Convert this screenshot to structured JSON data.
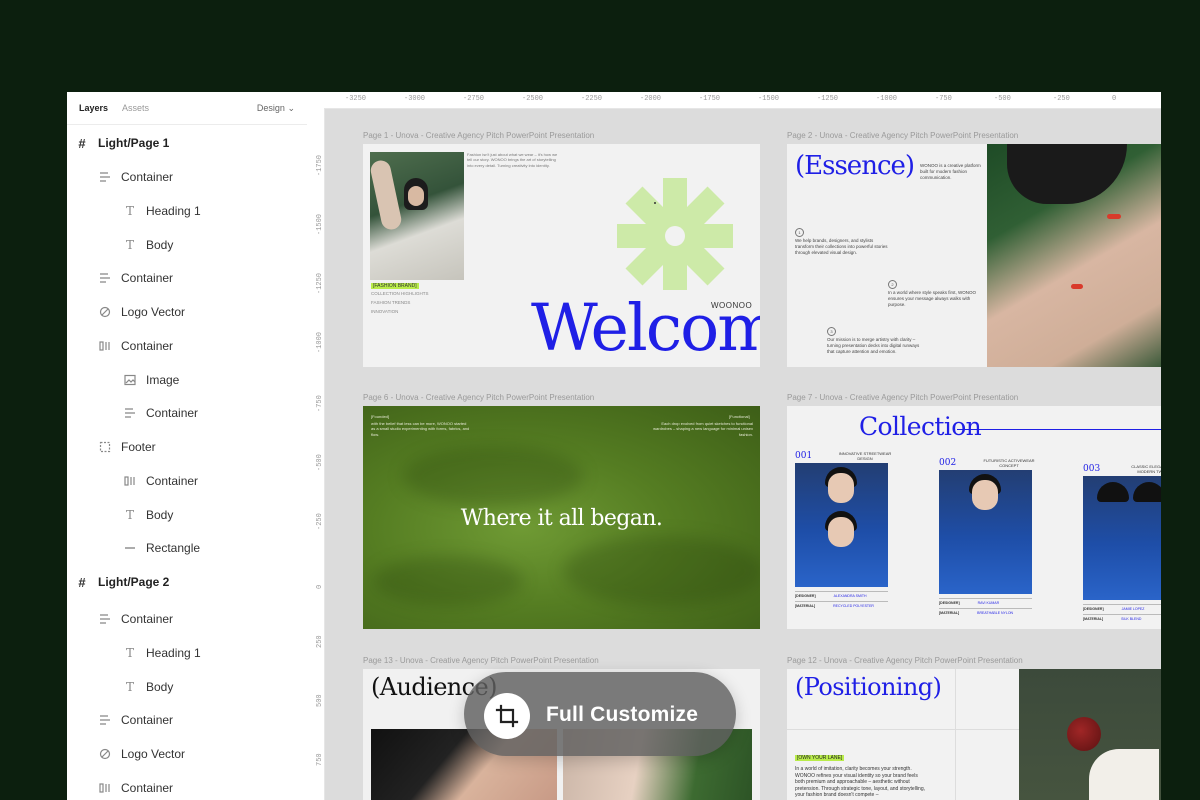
{
  "sidebar": {
    "tabs": {
      "layers": "Layers",
      "assets": "Assets"
    },
    "design_label": "Design",
    "layers": [
      {
        "label": "Light/Page 1",
        "icon": "frame-icon",
        "type": "frame"
      },
      {
        "label": "Container",
        "icon": "container-icon",
        "type": "item"
      },
      {
        "label": "Heading 1",
        "icon": "text-icon",
        "type": "item"
      },
      {
        "label": "Body",
        "icon": "text-icon",
        "type": "item"
      },
      {
        "label": "Container",
        "icon": "container-icon",
        "type": "item"
      },
      {
        "label": "Logo Vector",
        "icon": "vector-icon",
        "type": "item"
      },
      {
        "label": "Container",
        "icon": "columns-icon",
        "type": "item"
      },
      {
        "label": "Image",
        "icon": "image-icon",
        "type": "item"
      },
      {
        "label": "Container",
        "icon": "container-icon",
        "type": "item"
      },
      {
        "label": "Footer",
        "icon": "dashed-frame-icon",
        "type": "item"
      },
      {
        "label": "Container",
        "icon": "columns-icon",
        "type": "item"
      },
      {
        "label": "Body",
        "icon": "text-icon",
        "type": "item"
      },
      {
        "label": "Rectangle",
        "icon": "line-icon",
        "type": "item"
      },
      {
        "label": "Light/Page 2",
        "icon": "frame-icon",
        "type": "frame"
      },
      {
        "label": "Container",
        "icon": "container-icon",
        "type": "item"
      },
      {
        "label": "Heading 1",
        "icon": "text-icon",
        "type": "item"
      },
      {
        "label": "Body",
        "icon": "text-icon",
        "type": "item"
      },
      {
        "label": "Container",
        "icon": "container-icon",
        "type": "item"
      },
      {
        "label": "Logo Vector",
        "icon": "vector-icon",
        "type": "item"
      },
      {
        "label": "Container",
        "icon": "columns-icon",
        "type": "item"
      }
    ]
  },
  "rulers": {
    "top": [
      "-3250",
      "-3000",
      "-2750",
      "-2500",
      "-2250",
      "-2000",
      "-1750",
      "-1500",
      "-1250",
      "-1000",
      "-750",
      "-500",
      "-250",
      "0"
    ],
    "left": [
      "-1750",
      "-1500",
      "-1250",
      "-1000",
      "-750",
      "-500",
      "-250",
      "0",
      "250",
      "500",
      "750"
    ]
  },
  "frames": {
    "page1": "Page 1 - Unova - Creative Agency Pitch PowerPoint Presentation",
    "page2": "Page 2 - Unova - Creative Agency Pitch PowerPoint Presentation",
    "page6": "Page 6 - Unova - Creative Agency Pitch PowerPoint Presentation",
    "page7": "Page 7 - Unova - Creative Agency Pitch PowerPoint Presentation",
    "page13": "Page 13 - Unova - Creative Agency Pitch PowerPoint Presentation",
    "page12": "Page 12 - Unova - Creative Agency Pitch PowerPoint Presentation"
  },
  "slide1": {
    "intro": "Fashion isn't just about what we wear – it's how we tell our story. WONOO brings the art of storytelling into every detail. Turning creativity into identity.",
    "tag": "[FASHION BRAND]",
    "items": [
      "COLLECTION HIGHLIGHTS",
      "FASHION TRENDS",
      "INNOVATION"
    ],
    "brand": "WOONOO",
    "welcome": "Welcome",
    "accent": "#cdeaa8"
  },
  "slide2": {
    "title": "(Essence)",
    "desc": "WONOO is a creative platform built for modern fashion communication.",
    "points": [
      {
        "n": "1",
        "text": "We help brands, designers, and stylists transform their collections into powerful stories through elevated visual design."
      },
      {
        "n": "2",
        "text": "In a world where style speaks first, WONOO ensures your message always walks with purpose."
      },
      {
        "n": "3",
        "text": "Our mission is to merge artistry with clarity – turning presentation decks into digital runways that capture attention and emotion."
      }
    ]
  },
  "slide6": {
    "left_label": "[Founded]",
    "left_text": "with the belief that less can be more, WONOO started as a small studio experimenting with forms, fabrics, and flow.",
    "right_label": "[Functional]",
    "right_text": "Each drop evolved from quiet sketches to functional wardrobes – shaping a new language for minimal unisex fashion.",
    "hero": "Where it all began."
  },
  "slide7": {
    "title": "Collection",
    "items": [
      {
        "num": "001",
        "desc": "INNOVATIVE STREETWEAR DESIGN",
        "designer_label": "[DESIGNER]",
        "designer": "ALEXANDRA SMITH",
        "material_label": "[MATERIAL]",
        "material": "RECYCLED POLYESTER"
      },
      {
        "num": "002",
        "desc": "FUTURISTIC ACTIVEWEAR CONCEPT",
        "designer_label": "[DESIGNER]",
        "designer": "RAVI KUMAR",
        "material_label": "[MATERIAL]",
        "material": "BREATHABLE NYLON"
      },
      {
        "num": "003",
        "desc": "CLASSIC ELEGANCE A MODERN TWIST",
        "designer_label": "[DESIGNER]",
        "designer": "JAMIE LOPEZ",
        "material_label": "[MATERIAL]",
        "material": "SILK BLEND"
      }
    ]
  },
  "slide13": {
    "title": "(Audience)"
  },
  "slide12": {
    "title": "(Positioning)",
    "tag": "[OWN YOUR LANE]",
    "body": "In a world of imitation, clarity becomes your strength. WONOO refines your visual identity so your brand feels both premium and approachable – aesthetic without pretension. Through strategic tone, layout, and storytelling, your fashion brand doesn't compete –"
  },
  "cta": {
    "label": "Full Customize",
    "icon": "crop-icon"
  }
}
